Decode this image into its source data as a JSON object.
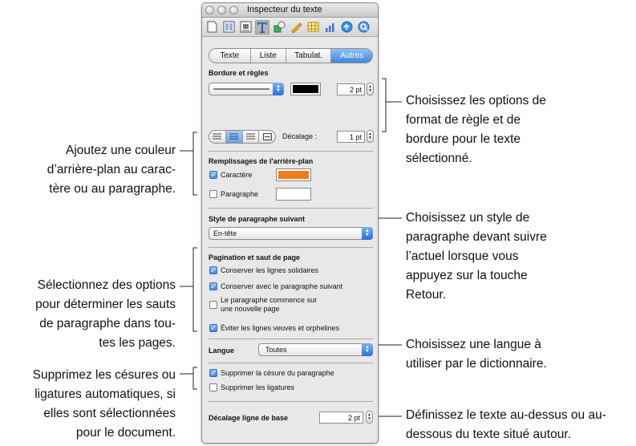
{
  "window": {
    "title": "Inspecteur du texte"
  },
  "toolbar": {
    "icons": [
      "document-icon",
      "layout-icon",
      "wrap-icon",
      "text-icon",
      "graphic-icon",
      "metrics-icon",
      "table-icon",
      "chart-icon",
      "link-icon",
      "quicktime-icon"
    ],
    "selected": "text-icon"
  },
  "tabs": [
    "Texte",
    "Liste",
    "Tabulat.",
    "Autres"
  ],
  "active_tab": "Autres",
  "border": {
    "heading": "Bordure et règles",
    "color": "#000000",
    "width_value": "2 pt",
    "offset_label": "Décalage :",
    "offset_value": "1 pt"
  },
  "background": {
    "heading": "Remplissages de l'arrière-plan",
    "character_label": "Caractère",
    "character_checked": true,
    "character_color": "#f07d1a",
    "paragraph_label": "Paragraphe",
    "paragraph_checked": false,
    "paragraph_color": "#ffffff"
  },
  "next_style": {
    "heading": "Style de paragraphe suivant",
    "value": "En-tête"
  },
  "pagination": {
    "heading": "Pagination et saut de page",
    "options": [
      {
        "label": "Conserver les lignes solidaires",
        "checked": true
      },
      {
        "label": "Conserver avec le paragraphe suivant",
        "checked": true
      },
      {
        "label_line1": "Le paragraphe commence sur",
        "label_line2": "une nouvelle page",
        "checked": false
      },
      {
        "label": "Éviter les lignes veuves et orphelines",
        "checked": true
      }
    ]
  },
  "language": {
    "label": "Langue",
    "value": "Toutes"
  },
  "hyphenation": {
    "options": [
      {
        "label": "Supprimer la césure du paragraphe",
        "checked": true
      },
      {
        "label": "Supprimer les ligatures",
        "checked": false
      }
    ]
  },
  "baseline": {
    "label": "Décalage ligne de base",
    "value": "2 pt"
  },
  "callouts": {
    "border": [
      "Choisissez les options de",
      "format de règle et de",
      "bordure pour le texte",
      "sélectionné."
    ],
    "background": [
      "Ajoutez une couleur",
      "d’arrière-plan au carac-",
      "tère ou au paragraphe."
    ],
    "next_style": [
      "Choisissez un style de",
      "paragraphe devant suivre",
      "l’actuel lorsque vous",
      "appuyez sur la touche",
      "Retour."
    ],
    "pagination": [
      "Sélectionnez des options",
      "pour déterminer les sauts",
      "de paragraphe dans tou-",
      "tes les pages."
    ],
    "language": [
      "Choisissez une langue à",
      "utiliser par le dictionnaire."
    ],
    "hyphenation": [
      "Supprimez les césures ou",
      "ligatures automatiques, si",
      "elles sont sélectionnées",
      "pour le document."
    ],
    "baseline": [
      "Définissez le texte au-dessus ou au-",
      "dessous du texte situé autour."
    ]
  }
}
